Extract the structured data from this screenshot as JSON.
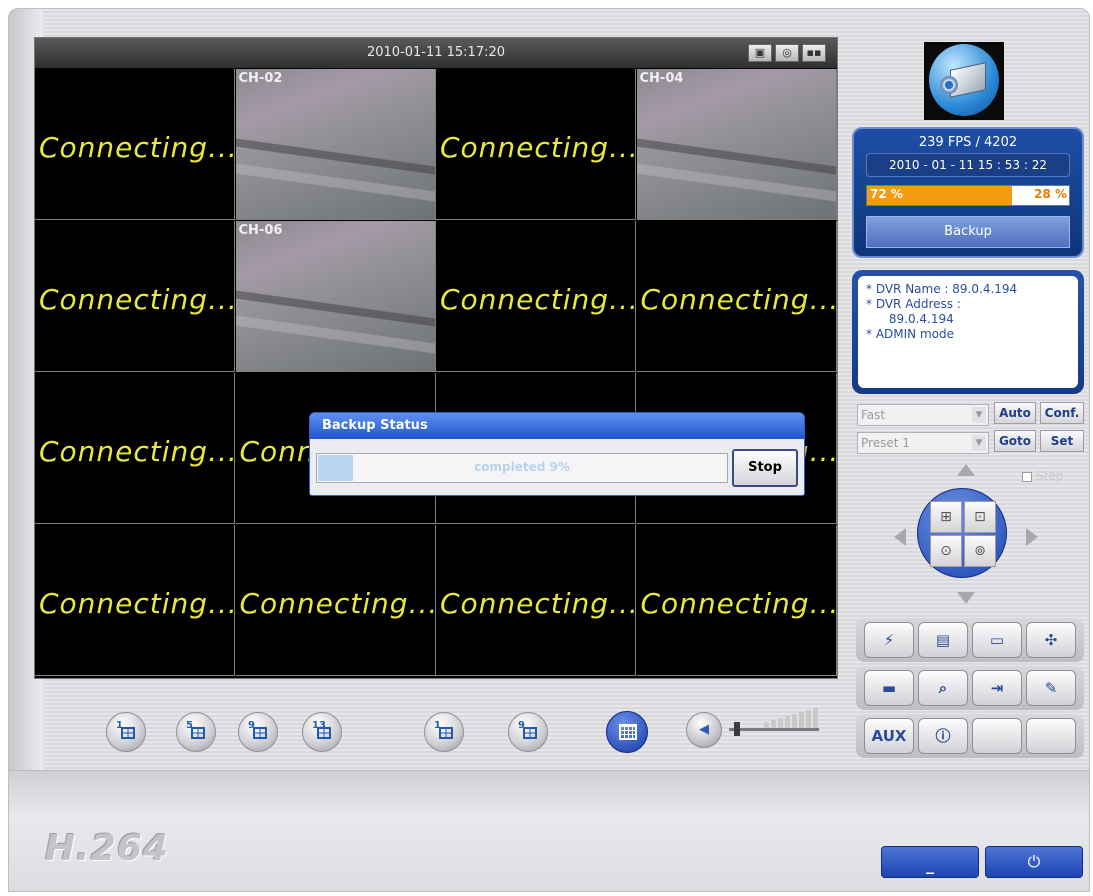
{
  "viewer": {
    "datetime": "2010-01-11 15:17:20",
    "tiles": [
      {
        "type": "msg",
        "text": "Connecting..."
      },
      {
        "type": "cam",
        "label": "CH-02"
      },
      {
        "type": "msg",
        "text": "Connecting..."
      },
      {
        "type": "cam",
        "label": "CH-04"
      },
      {
        "type": "msg",
        "text": "Connecting..."
      },
      {
        "type": "cam",
        "label": "CH-06"
      },
      {
        "type": "msg",
        "text": "Connecting..."
      },
      {
        "type": "msg",
        "text": "Connecting..."
      },
      {
        "type": "msg",
        "text": "Connecting..."
      },
      {
        "type": "msg",
        "text": "Connecting..."
      },
      {
        "type": "msg",
        "text": "Connecting..."
      },
      {
        "type": "msg",
        "text": "Connecting..."
      },
      {
        "type": "msg",
        "text": "Connecting..."
      },
      {
        "type": "msg",
        "text": "Connecting..."
      },
      {
        "type": "msg",
        "text": "Connecting..."
      },
      {
        "type": "msg",
        "text": "Connecting..."
      }
    ]
  },
  "layout_buttons": [
    "1",
    "5",
    "9",
    "13",
    "1",
    "9"
  ],
  "status": {
    "fps": "239 FPS / 4202",
    "clock": "2010 - 01 - 11  15 : 53 : 22",
    "disk_used": "72 %",
    "disk_free": "28 %",
    "disk_used_fraction": 0.72,
    "backup_label": "Backup"
  },
  "info": {
    "lines": [
      "* DVR Name : 89.0.4.194",
      "* DVR Address :",
      "      89.0.4.194",
      "* ADMIN mode"
    ]
  },
  "ptz": {
    "speed_value": "Fast",
    "preset_value": "Preset 1",
    "auto_label": "Auto",
    "conf_label": "Conf.",
    "goto_label": "Goto",
    "set_label": "Set",
    "step_label": "Step"
  },
  "tools": {
    "aux_label": "AUX"
  },
  "dialog": {
    "title": "Backup Status",
    "progress_text": "completed 9%",
    "progress_fraction": 0.09,
    "stop_label": "Stop"
  },
  "brand": "H.264",
  "colors": {
    "connecting_text": "#e8e83a",
    "panel_blue": "#1e4fa6",
    "disk_orange": "#f59b12"
  }
}
